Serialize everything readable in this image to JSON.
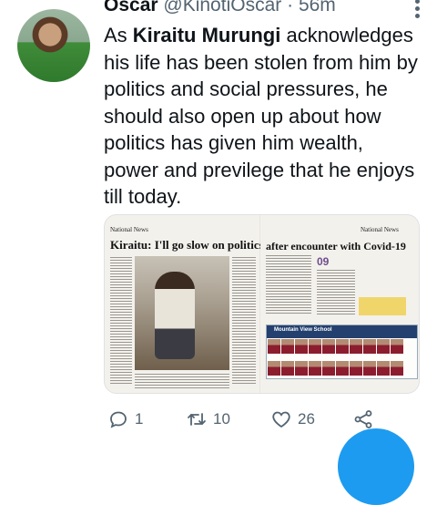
{
  "tweet": {
    "author_name": "Oscar",
    "handle": "@KinotiOscar",
    "separator": "·",
    "time": "56m",
    "text_bold": "Kiraitu Murungi",
    "text_before": "As ",
    "text_after": " acknowledges his life has been stolen from him by politics and social pressures, he should also open up about how politics has given him wealth, power and previlege that he enjoys till today."
  },
  "media": {
    "left_page": {
      "section": "National News",
      "headline": "Kiraitu: I'll go slow on politics"
    },
    "right_page": {
      "section": "National News",
      "headline": "after encounter with Covid-19",
      "ad_title": "Mountain View School",
      "number": "09"
    }
  },
  "actions": {
    "reply_count": "1",
    "retweet_count": "10",
    "like_count": "26"
  },
  "colors": {
    "accent": "#1d9bf0",
    "muted": "#536471"
  }
}
